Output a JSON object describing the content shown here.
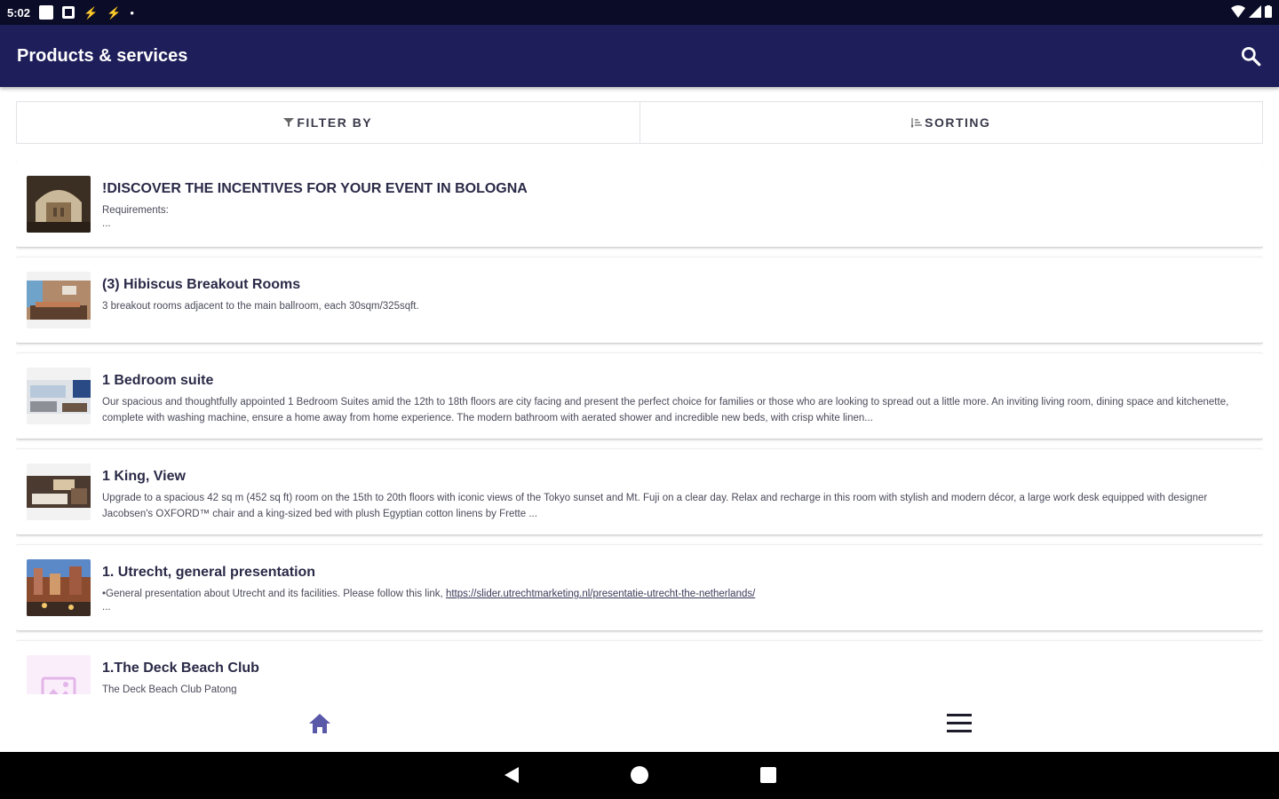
{
  "status_bar": {
    "time": "5:02"
  },
  "app_bar": {
    "title": "Products & services"
  },
  "filter_bar": {
    "filter_label": "FILTER BY",
    "sorting_label": "SORTING"
  },
  "items": [
    {
      "title": "!DISCOVER THE INCENTIVES FOR YOUR EVENT IN BOLOGNA",
      "description": "Requirements:",
      "extra": "..."
    },
    {
      "title": "(3) Hibiscus Breakout Rooms",
      "description": "3 breakout rooms adjacent to the main ballroom, each 30sqm/325sqft."
    },
    {
      "title": "1 Bedroom suite",
      "description": "Our spacious and thoughtfully appointed 1 Bedroom Suites amid the 12th to 18th floors are city facing and present the perfect choice for families or those who are looking to spread out a little more. An inviting living room, dining space and kitchenette, complete with washing machine, ensure a home away from home experience. The modern bathroom with aerated shower and incredible new beds, with crisp white linen..."
    },
    {
      "title": "1 King, View",
      "description": "Upgrade to a spacious 42 sq m (452 sq ft) room on the 15th to 20th floors with iconic views of the Tokyo sunset and Mt. Fuji on a clear day. Relax and recharge in this room with stylish and modern décor, a large work desk equipped with designer Jacobsen's OXFORD™ chair and a king-sized bed with plush Egyptian cotton linens by Frette ..."
    },
    {
      "title": "1. Utrecht, general presentation",
      "description_prefix": "•General presentation about Utrecht and its facilities. Please follow this link,",
      "link": "https://slider.utrechtmarketing.nl/presentatie-utrecht-the-netherlands/",
      "extra": "..."
    },
    {
      "title": "1.The Deck Beach Club",
      "description": "The Deck Beach Club Patong"
    }
  ],
  "colors": {
    "app_bar": "#1e1e5a",
    "status_bar": "#0b0d28",
    "accent": "#5a58a8"
  },
  "icons": {
    "search": "search-icon",
    "home": "home-icon",
    "menu": "menu-icon"
  }
}
